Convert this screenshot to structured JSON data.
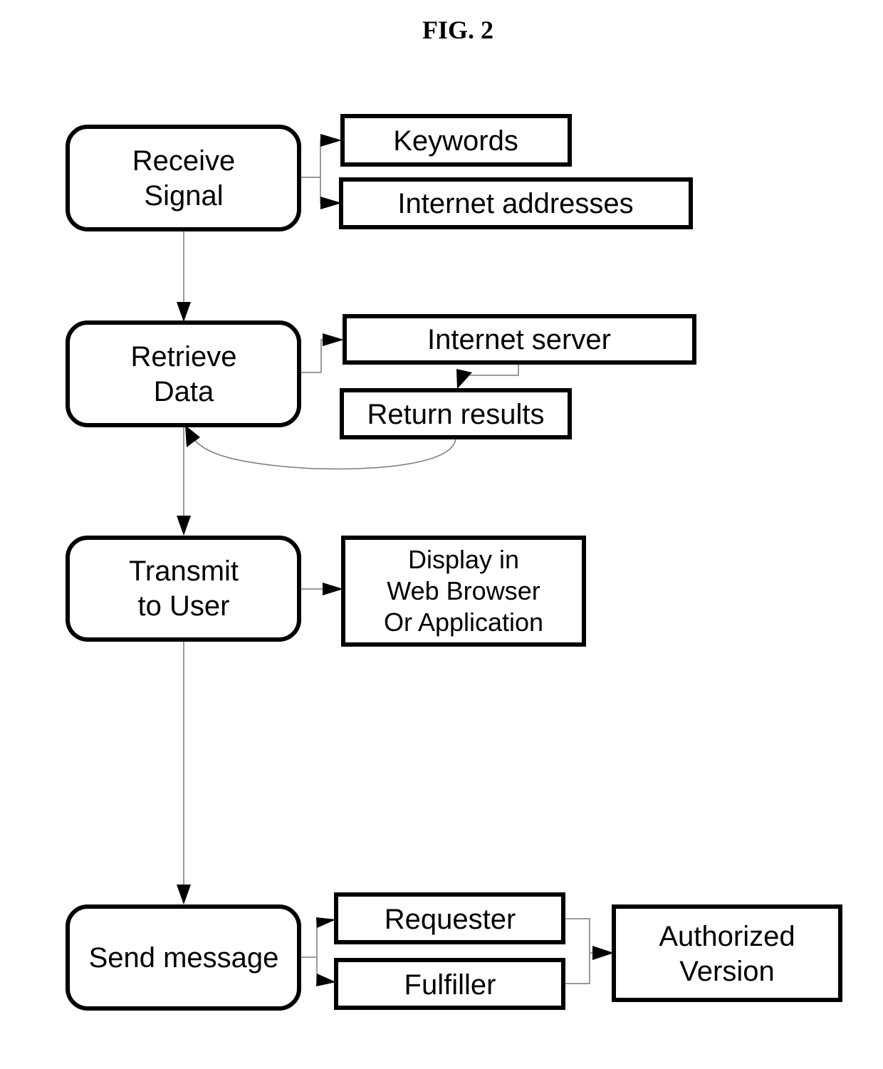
{
  "figure": {
    "title": "FIG. 2"
  },
  "steps": [
    {
      "id": "receive-signal",
      "lines": [
        "Receive",
        "Signal"
      ]
    },
    {
      "id": "retrieve-data",
      "lines": [
        "Retrieve",
        "Data"
      ]
    },
    {
      "id": "transmit-to-user",
      "lines": [
        "Transmit",
        "to User"
      ]
    },
    {
      "id": "send-message",
      "lines": [
        "Send message"
      ]
    }
  ],
  "details": {
    "keywords": [
      "Keywords"
    ],
    "internet_addresses": [
      "Internet addresses"
    ],
    "internet_server": [
      "Internet server"
    ],
    "return_results": [
      "Return results"
    ],
    "display": [
      "Display in",
      "Web Browser",
      "Or Application"
    ],
    "requester": [
      "Requester"
    ],
    "fulfiller": [
      "Fulfiller"
    ],
    "authorized_version": [
      "Authorized",
      "Version"
    ]
  }
}
